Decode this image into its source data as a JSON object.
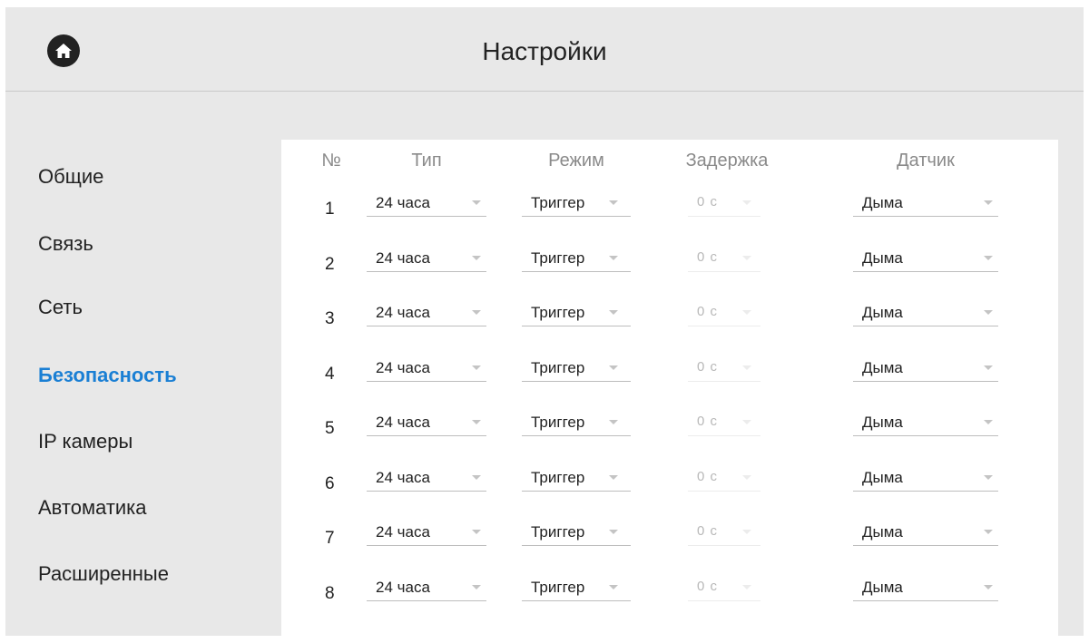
{
  "header": {
    "title": "Настройки",
    "home_icon": "home-icon"
  },
  "sidebar": {
    "items": [
      {
        "label": "Общие",
        "active": false
      },
      {
        "label": "Связь",
        "active": false
      },
      {
        "label": "Сеть",
        "active": false
      },
      {
        "label": "Безопасность",
        "active": true
      },
      {
        "label": "IP камеры",
        "active": false
      },
      {
        "label": "Автоматика",
        "active": false
      },
      {
        "label": "Расширенные",
        "active": false
      }
    ]
  },
  "table": {
    "headers": {
      "num": "№",
      "type": "Тип",
      "mode": "Режим",
      "delay": "Задержка",
      "sensor": "Датчик"
    },
    "rows": [
      {
        "num": "1",
        "type": "24 часа",
        "mode": "Триггер",
        "delay": "0 с",
        "sensor": "Дыма"
      },
      {
        "num": "2",
        "type": "24 часа",
        "mode": "Триггер",
        "delay": "0 с",
        "sensor": "Дыма"
      },
      {
        "num": "3",
        "type": "24 часа",
        "mode": "Триггер",
        "delay": "0 с",
        "sensor": "Дыма"
      },
      {
        "num": "4",
        "type": "24 часа",
        "mode": "Триггер",
        "delay": "0 с",
        "sensor": "Дыма"
      },
      {
        "num": "5",
        "type": "24 часа",
        "mode": "Триггер",
        "delay": "0 с",
        "sensor": "Дыма"
      },
      {
        "num": "6",
        "type": "24 часа",
        "mode": "Триггер",
        "delay": "0 с",
        "sensor": "Дыма"
      },
      {
        "num": "7",
        "type": "24 часа",
        "mode": "Триггер",
        "delay": "0 с",
        "sensor": "Дыма"
      },
      {
        "num": "8",
        "type": "24 часа",
        "mode": "Триггер",
        "delay": "0 с",
        "sensor": "Дыма"
      }
    ]
  },
  "colors": {
    "accent": "#1a7fd4",
    "background": "#e8e8e8",
    "panel": "#ffffff"
  }
}
